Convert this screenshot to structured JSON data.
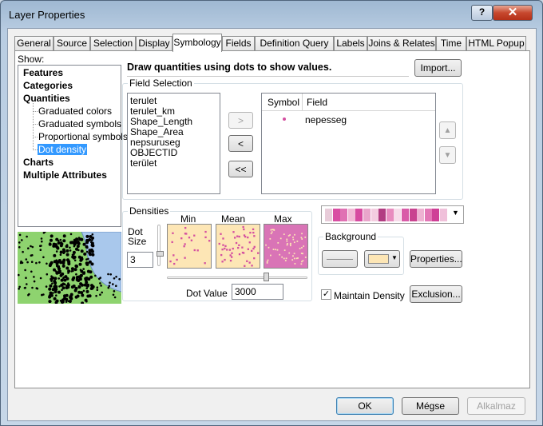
{
  "window": {
    "title": "Layer Properties",
    "help_glyph": "?",
    "close_glyph": "✕"
  },
  "tabs": [
    "General",
    "Source",
    "Selection",
    "Display",
    "Symbology",
    "Fields",
    "Definition Query",
    "Labels",
    "Joins & Relates",
    "Time",
    "HTML Popup"
  ],
  "active_tab": "Symbology",
  "show": {
    "label": "Show:",
    "tree": [
      {
        "label": "Features",
        "bold": true
      },
      {
        "label": "Categories",
        "bold": true
      },
      {
        "label": "Quantities",
        "bold": true
      },
      {
        "label": "Graduated colors",
        "bold": false
      },
      {
        "label": "Graduated symbols",
        "bold": false
      },
      {
        "label": "Proportional symbols",
        "bold": false
      },
      {
        "label": "Dot density",
        "bold": false,
        "selected": true
      },
      {
        "label": "Charts",
        "bold": true
      },
      {
        "label": "Multiple Attributes",
        "bold": true
      }
    ]
  },
  "description": "Draw quantities using dots to show values.",
  "import_button": "Import...",
  "field_selection": {
    "title": "Field Selection",
    "fields": [
      "terulet",
      "terulet_km",
      "Shape_Length",
      "Shape_Area",
      "nepsuruseg",
      "OBJECTID",
      "terület"
    ],
    "move_right": ">",
    "move_left": "<",
    "move_all_left": "<<",
    "table_headers": [
      "Symbol",
      "Field"
    ],
    "selected_fields": [
      {
        "symbol_color": "#d44fa0",
        "field": "nepesseg"
      }
    ],
    "up_arrow": "▲",
    "down_arrow": "▼"
  },
  "densities": {
    "title": "Densities",
    "dot_size_label": "Dot\nSize",
    "dot_size_line1": "Dot",
    "dot_size_line2": "Size",
    "dot_size_value": "3",
    "min_label": "Min",
    "mean_label": "Mean",
    "max_label": "Max",
    "dot_value_label": "Dot Value",
    "dot_value": "3000",
    "slider_position": 0.72
  },
  "color_ramp": [
    "#e8ccd9",
    "#d94fa3",
    "#e071b3",
    "#f2b9d6",
    "#d74ba0",
    "#e9a6cb",
    "#f4cde0",
    "#b23d82",
    "#e88cbf",
    "#f7dcea",
    "#d95ca8",
    "#c94390",
    "#eeb2d2",
    "#e377b6",
    "#cf3f96",
    "#f0c0da"
  ],
  "background": {
    "title": "Background",
    "fill_color": "#fde6b5"
  },
  "properties_button": "Properties...",
  "maintain_density": {
    "label": "Maintain Density",
    "checked": true
  },
  "exclusion_button": "Exclusion...",
  "footer": {
    "ok": "OK",
    "cancel": "Mégse",
    "apply": "Alkalmaz"
  },
  "colors": {
    "swatch_fill": "#fde6b5",
    "dot_color": "#d44fa0",
    "preview_land": "#8ed36f",
    "preview_water": "#a9c8ec"
  }
}
